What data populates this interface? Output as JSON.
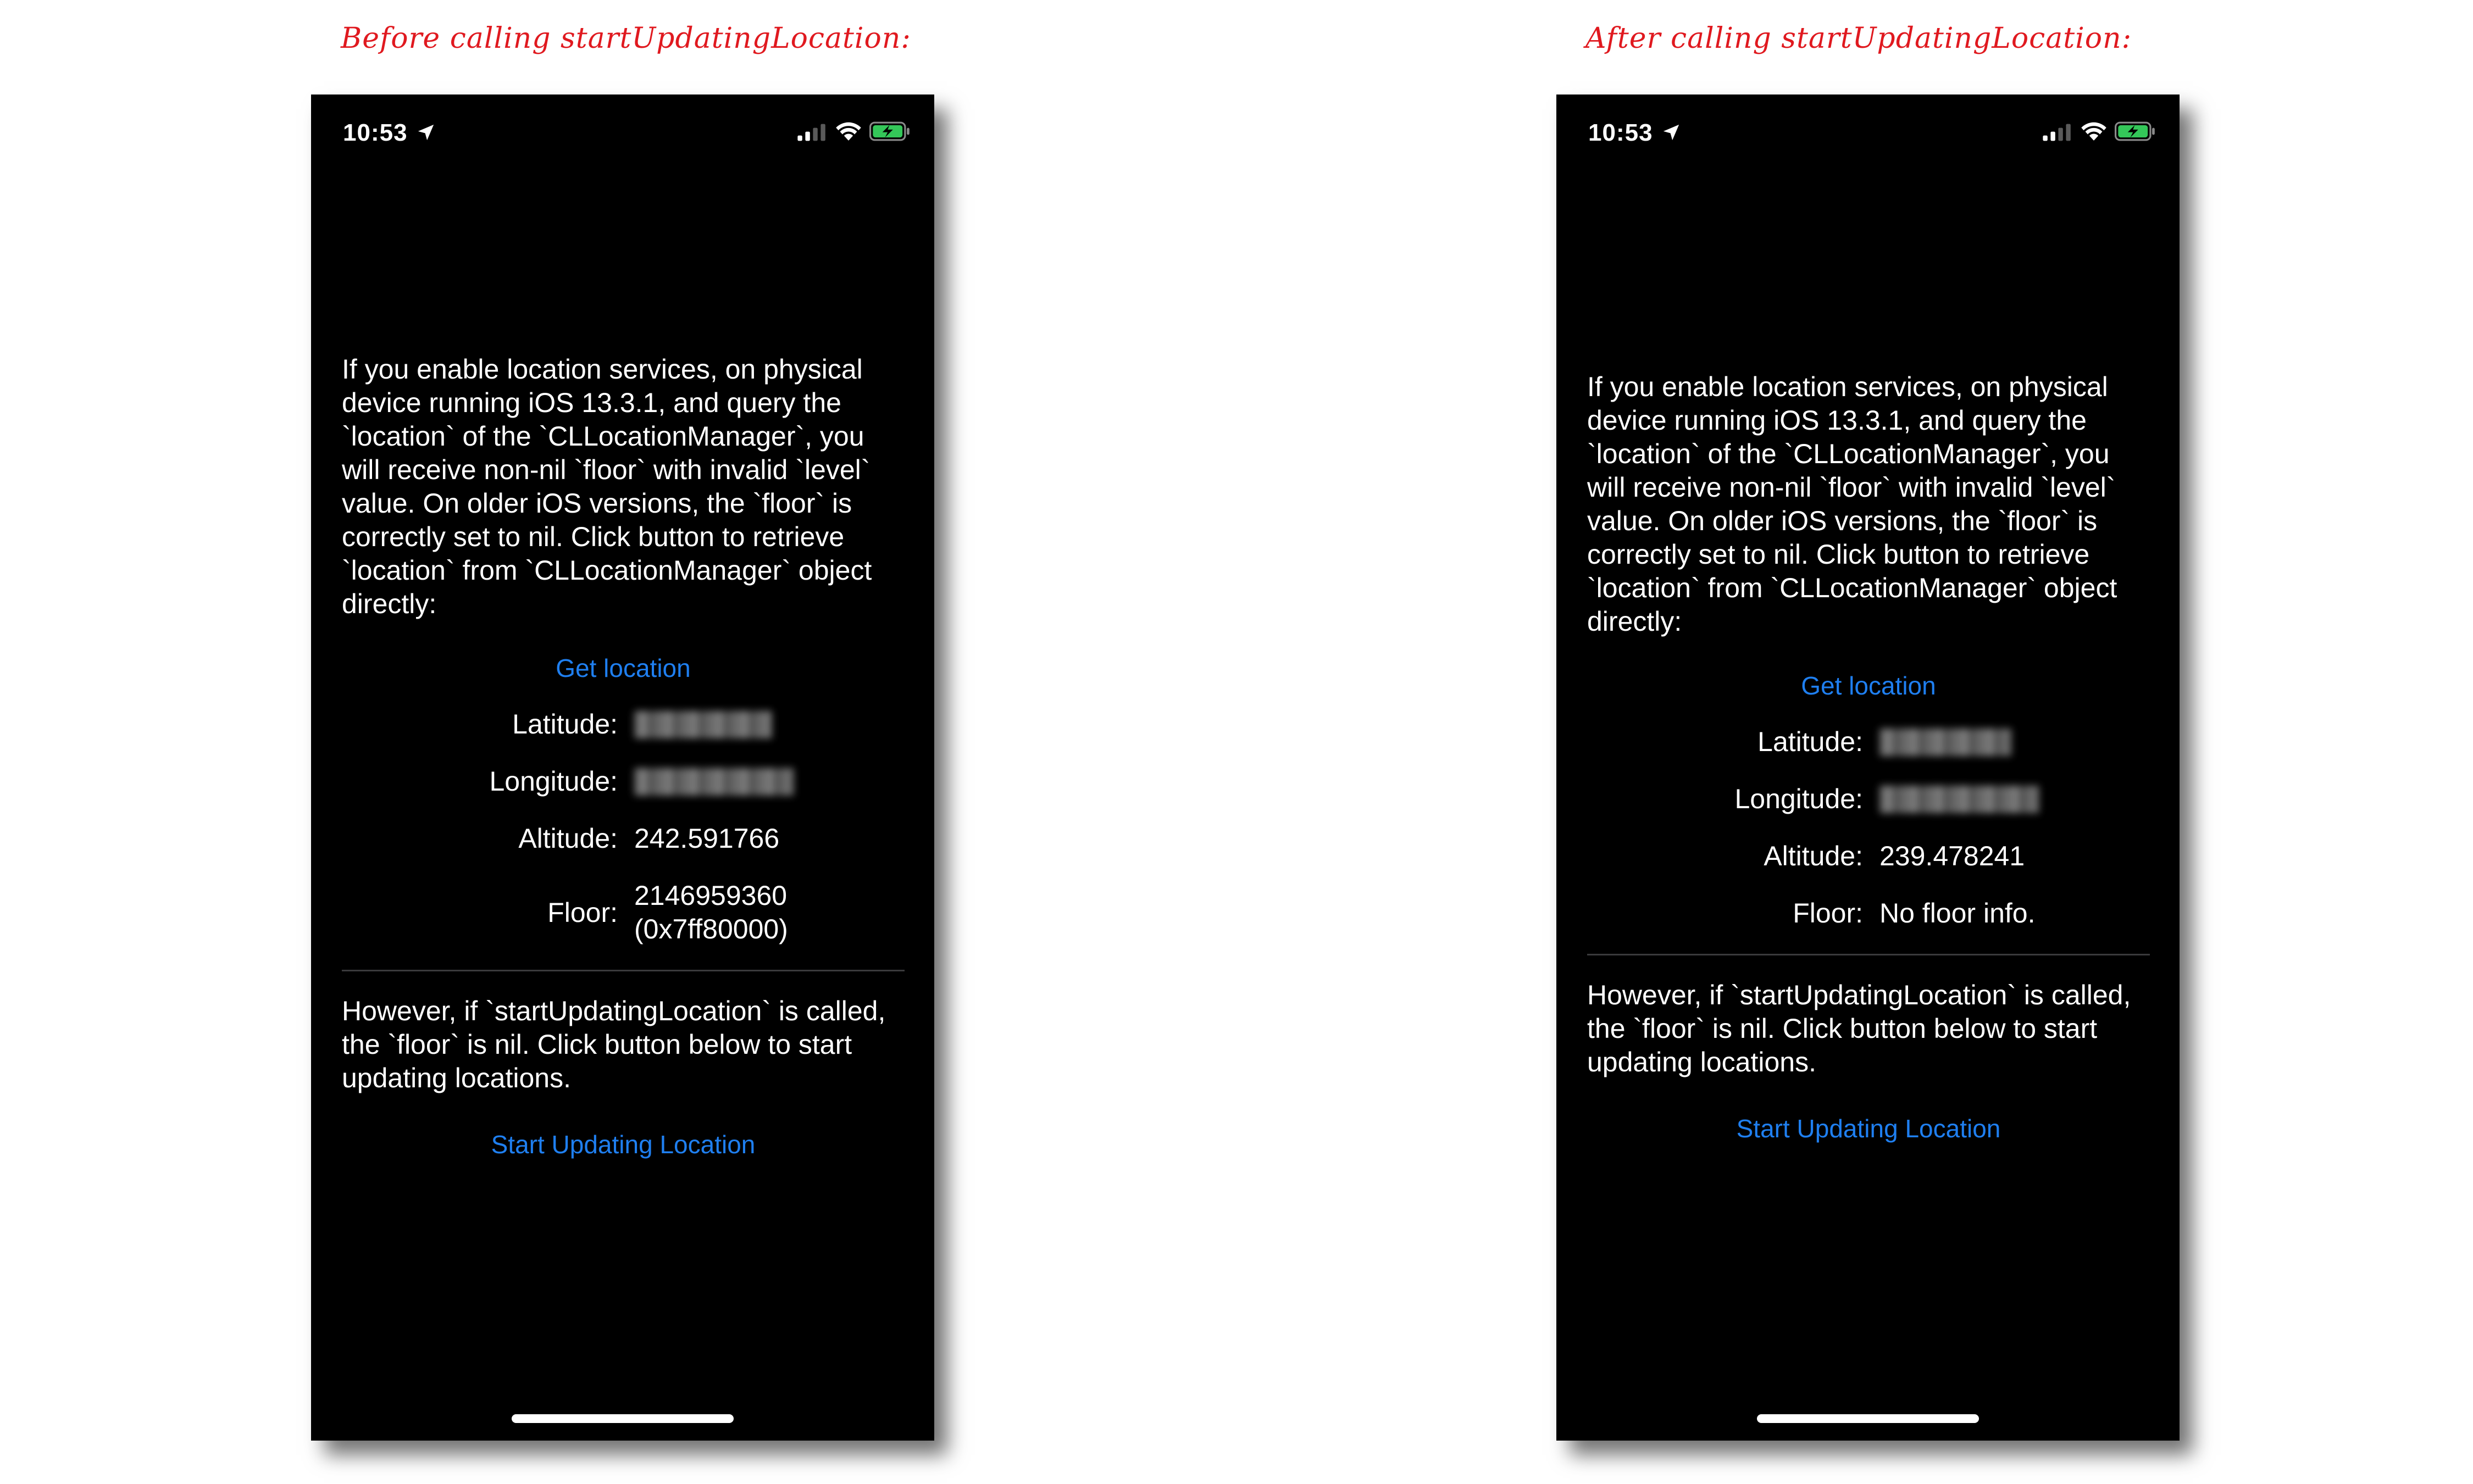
{
  "captions": {
    "before": "Before calling startUpdatingLocation:",
    "after": "After calling startUpdatingLocation:"
  },
  "colors": {
    "caption": "#e0191f",
    "link": "#1f7ff0",
    "background": "#000000",
    "text": "#ffffff"
  },
  "screens": {
    "before": {
      "status": {
        "time": "10:53",
        "icons": [
          "location-arrow-icon",
          "cellular-signal-icon",
          "wifi-icon",
          "battery-charging-icon"
        ]
      },
      "intro": "If you enable location services, on physical device running iOS 13.3.1, and query the `location` of the `CLLocationManager`, you will receive non-nil `floor` with invalid `level` value. On older iOS versions, the `floor` is correctly set to nil. Click button to retrieve `location` from `CLLocationManager` object directly:",
      "get_location_label": "Get location",
      "latitude_label": "Latitude:",
      "longitude_label": "Longitude:",
      "altitude_label": "Altitude:",
      "altitude_value": "242.591766",
      "floor_label": "Floor:",
      "floor_value": "2146959360\n(0x7ff80000)",
      "outro": "However, if `startUpdatingLocation` is called, the `floor` is nil. Click button below to start updating locations.",
      "start_updating_label": "Start Updating Location"
    },
    "after": {
      "status": {
        "time": "10:53",
        "icons": [
          "location-arrow-icon",
          "cellular-signal-icon",
          "wifi-icon",
          "battery-charging-icon"
        ]
      },
      "intro": "If you enable location services, on physical device running iOS 13.3.1, and query the `location` of the `CLLocationManager`, you will receive non-nil `floor` with invalid `level` value. On older iOS versions, the `floor` is correctly set to nil. Click button to retrieve `location` from `CLLocationManager` object directly:",
      "get_location_label": "Get location",
      "latitude_label": "Latitude:",
      "longitude_label": "Longitude:",
      "altitude_label": "Altitude:",
      "altitude_value": "239.478241",
      "floor_label": "Floor:",
      "floor_value": "No floor info.",
      "outro": "However, if `startUpdatingLocation` is called, the `floor` is nil. Click button below to start updating locations.",
      "start_updating_label": "Start Updating Location"
    }
  }
}
